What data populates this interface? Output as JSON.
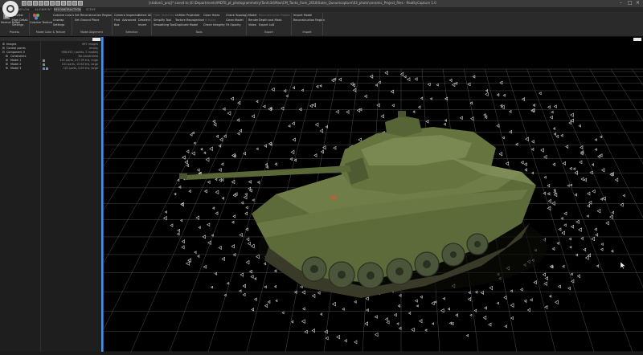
{
  "window": {
    "title": "[station1_proj]* saved to (E:\\Departments\\MDTE_pt_photogrammetry\\Tank\\3d\\Max\\CM_Tanks_from_2018\\Sales_Queue\\capture\\03_photo\\ceramic_Project_files - RealityCapture 1.0"
  },
  "tabs": [
    "WORKFLOW",
    "ALIGNMENT",
    "RECONSTRUCTION",
    "SCENE"
  ],
  "ribbon": {
    "groups": [
      {
        "label": "Process",
        "items": [
          "Normal Detail",
          "Preview",
          "High Detail",
          "Settings"
        ]
      },
      {
        "label": "Model Color & Texture",
        "items": [
          "Colorize Texture",
          "Colorize Colors",
          "Unwrap",
          "Settings"
        ]
      },
      {
        "label": "Model Alignment",
        "items": [
          "Set Reconstruction Region",
          "Set Ground Plane"
        ]
      },
      {
        "label": "Selection",
        "items": [
          "Camera Inspector",
          "Filter Selected",
          "Select All",
          "Find",
          "Advanced",
          "Deselect",
          "Box",
          "Invert"
        ]
      },
      {
        "label": "Tools",
        "items": [
          "Filter Selection",
          "Unfilter Projected",
          "Close Holes",
          "Check Topology",
          "Simplify Tool",
          "Texture Reprojection",
          "Fill Holes",
          "Clean Model",
          "Smoothing Tool",
          "Duplicate Model",
          "Check Integrity",
          "Fit Opacity"
        ]
      },
      {
        "label": "Export",
        "items": [
          "Model",
          "Reconstruction Region",
          "Render",
          "Depth and Mask",
          "Video",
          "Export LoD"
        ]
      },
      {
        "label": "Import",
        "items": [
          "Import Model",
          "Reconstruction Region"
        ]
      }
    ]
  },
  "tree": [
    {
      "label": "Images",
      "value": "697 images"
    },
    {
      "label": "Control points",
      "value": "empty"
    },
    {
      "label": "Component 0",
      "value": "908,952 / points, 2 models"
    },
    {
      "label": "Constraints",
      "value": "No constraints"
    },
    {
      "label": "Model 1",
      "value": "101 parts, 217.99 tris, huge"
    },
    {
      "label": "Model 2",
      "value": "101 parts, 10.60 tris, large"
    },
    {
      "label": "Model 3",
      "value": "101 parts, 0.69 tris, large"
    }
  ],
  "colors": {
    "accent": "#4d8fd6",
    "grid": "#5a5a5a",
    "background": "#000000",
    "model": "#5d6b3a"
  },
  "icons": [
    "app-logo-icon",
    "cursor-icon",
    "folder-icon",
    "camera-icon"
  ]
}
